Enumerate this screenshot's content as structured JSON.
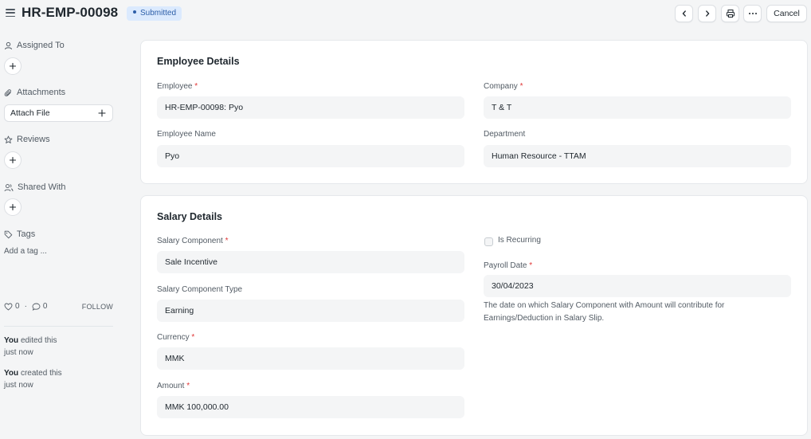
{
  "header": {
    "title": "HR-EMP-00098",
    "status": "Submitted",
    "cancel_label": "Cancel"
  },
  "sidebar": {
    "assigned_to": "Assigned To",
    "attachments": "Attachments",
    "attach_file": "Attach File",
    "reviews": "Reviews",
    "shared_with": "Shared With",
    "tags": "Tags",
    "add_tag": "Add a tag ...",
    "likes": "0",
    "comments": "0",
    "follow": "FOLLOW",
    "activity": [
      {
        "who": "You",
        "action": "edited this",
        "when": "just now"
      },
      {
        "who": "You",
        "action": "created this",
        "when": "just now"
      }
    ]
  },
  "employee_details": {
    "title": "Employee Details",
    "employee_label": "Employee",
    "employee_value": "HR-EMP-00098: Pyo",
    "company_label": "Company",
    "company_value": "T & T",
    "employee_name_label": "Employee Name",
    "employee_name_value": "Pyo",
    "department_label": "Department",
    "department_value": "Human Resource - TTAM"
  },
  "salary_details": {
    "title": "Salary Details",
    "salary_component_label": "Salary Component",
    "salary_component_value": "Sale Incentive",
    "is_recurring_label": "Is Recurring",
    "salary_component_type_label": "Salary Component Type",
    "salary_component_type_value": "Earning",
    "payroll_date_label": "Payroll Date",
    "payroll_date_value": "30/04/2023",
    "payroll_date_help": "The date on which Salary Component with Amount will contribute for Earnings/Deduction in Salary Slip.",
    "currency_label": "Currency",
    "currency_value": "MMK",
    "amount_label": "Amount",
    "amount_value": "MMK 100,000.00"
  },
  "required_marker": "*"
}
